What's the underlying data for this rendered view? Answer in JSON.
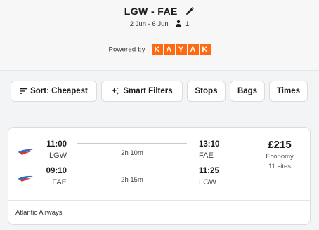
{
  "header": {
    "route": "LGW - FAE",
    "dates": "2 Jun - 6 Jun",
    "passengers": "1",
    "powered_by": "Powered by",
    "provider_letters": [
      "K",
      "A",
      "Y",
      "A",
      "K"
    ],
    "provider_color": "#ff690f"
  },
  "filters": {
    "sort_label": "Sort: Cheapest",
    "smart_label": "Smart Filters",
    "stops_label": "Stops",
    "bags_label": "Bags",
    "times_label": "Times"
  },
  "result": {
    "outbound": {
      "dep_time": "11:00",
      "dep_code": "LGW",
      "duration": "2h 10m",
      "arr_time": "13:10",
      "arr_code": "FAE"
    },
    "inbound": {
      "dep_time": "09:10",
      "dep_code": "FAE",
      "duration": "2h 15m",
      "arr_time": "11:25",
      "arr_code": "LGW"
    },
    "price": "£215",
    "cabin": "Economy",
    "sites": "11 sites",
    "airline": "Atlantic Airways"
  },
  "icons": {
    "edit": "pencil-icon",
    "person": "person-icon",
    "sort": "sort-lines-icon",
    "smart": "sparkle-icon",
    "airline": "airline-logo"
  }
}
